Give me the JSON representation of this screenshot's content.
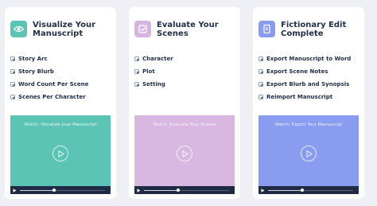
{
  "cards": [
    {
      "title": "Visualize Your Manuscript",
      "icon": "eye-icon",
      "icon_bg": "#5bc4b4",
      "features": [
        "Story Arc",
        "Story Blurb",
        "Word Count Per Scene",
        "Scenes Per Character"
      ],
      "video": {
        "caption": "Watch: Visualize your Manuscript",
        "color": "#5bc4b4",
        "progress": 0.4
      }
    },
    {
      "title": "Evaluate Your Scenes",
      "icon": "checklist-icon",
      "icon_bg": "#d5b5df",
      "features": [
        "Character",
        "Plot",
        "Setting"
      ],
      "video": {
        "caption": "Watch: Evaluate Your Scenes",
        "color": "#d8b7e0",
        "progress": 0.4
      }
    },
    {
      "title": "Fictionary Edit Complete",
      "icon": "export-document-icon",
      "icon_bg": "#8a9cf0",
      "features": [
        "Export Manuscript to Word",
        "Export Scene Notes",
        "Export Blurb and Synopsis",
        "Reimport Manuscript"
      ],
      "video": {
        "caption": "Watch: Export Your Manuscript",
        "color": "#8a9cf0",
        "progress": 0.4
      }
    }
  ]
}
